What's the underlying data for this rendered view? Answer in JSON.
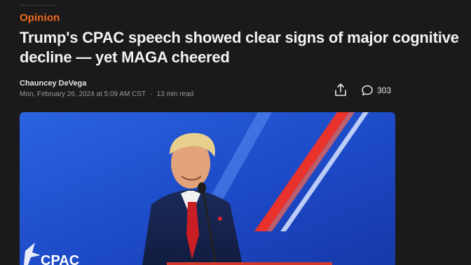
{
  "article": {
    "section": "Opinion",
    "headline": "Trump's CPAC speech showed clear signs of major cognitive decline — yet MAGA cheered",
    "author": "Chauncey DeVega",
    "published": "Mon, February 26, 2024 at 5:09 AM CST",
    "separator": "·",
    "read_time": "13 min read"
  },
  "actions": {
    "share_icon": "share-icon",
    "comment_icon": "comment-icon",
    "comment_count": "303"
  },
  "hero_image": {
    "backdrop_text": "CPAC"
  },
  "colors": {
    "accent": "#f06a1d",
    "background": "#1a1a1a",
    "hero_blue": "#1f4fd0",
    "stripe_red": "#e8322b"
  }
}
